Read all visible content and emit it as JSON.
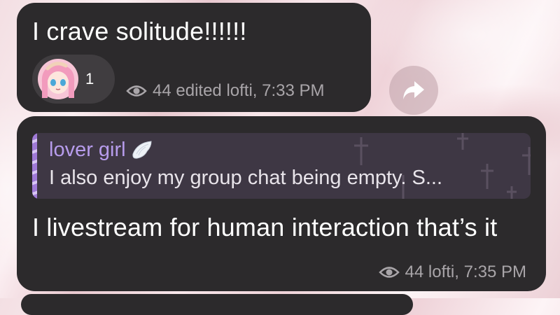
{
  "messages": [
    {
      "text": "I crave solitude!!!!!!",
      "reaction": {
        "emoji": "anime-avatar",
        "count": "1"
      },
      "views": "44",
      "status": "edited",
      "author": "lofti",
      "time": "7:33 PM"
    },
    {
      "reply": {
        "author": "lover girl",
        "author_badge": "angel-wing-icon",
        "text": "I also enjoy my group chat being empty. S..."
      },
      "text": "I livestream for human interaction that’s it",
      "views": "44",
      "author": "lofti",
      "time": "7:35 PM"
    }
  ],
  "colors": {
    "bubble": "#2c2a2c",
    "reply_accent": "#b79cec",
    "meta": "#a9a5a9",
    "background": "#f3dfe3"
  }
}
